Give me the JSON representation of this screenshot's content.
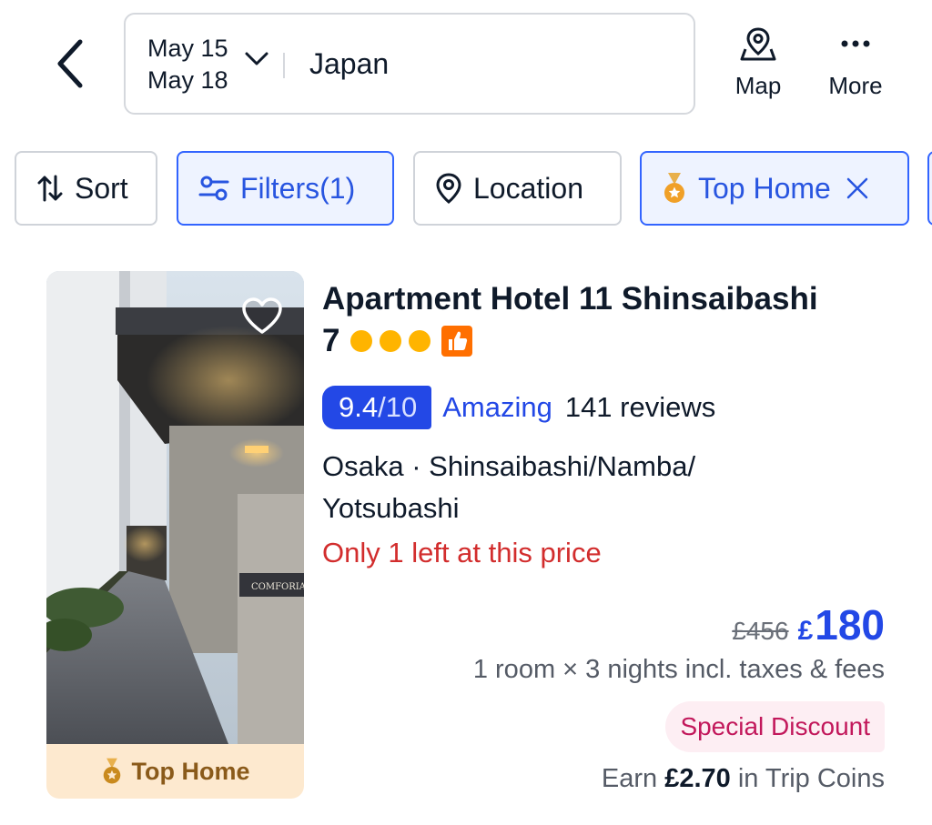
{
  "header": {
    "dates": {
      "check_in": "May 15",
      "check_out": "May 18"
    },
    "destination": "Japan",
    "map_label": "Map",
    "more_label": "More"
  },
  "filters": {
    "sort_label": "Sort",
    "filters_label": "Filters(1)",
    "location_label": "Location",
    "top_home_label": "Top Home"
  },
  "listing": {
    "name_line1": "Apartment Hotel 11 Shinsaibashi",
    "name_line2": "7",
    "star_rating": 3,
    "score_value": "9.4",
    "score_sep": "/",
    "score_max": "10",
    "rating_word": "Amazing",
    "reviews": "141 reviews",
    "location_line1": "Osaka · Shinsaibashi/Namba/",
    "location_line2": "Yotsubashi",
    "scarcity": "Only 1 left at this price",
    "old_price": "£456",
    "currency": "£",
    "price": "180",
    "price_note": "1 room × 3 nights incl. taxes & fees",
    "discount_label": "Special Discount",
    "coins_prefix": "Earn",
    "coins_amount": "£2.70",
    "coins_suffix": "in Trip Coins",
    "image_badge": "Top Home",
    "image_sign": "COMFORIA"
  },
  "colors": {
    "brand_blue": "#2348e6",
    "chip_active_bg": "#eef3ff",
    "scarcity_red": "#d22d2d",
    "discount_pink": "#c2185b",
    "medal_orange": "#f0a028",
    "star_yellow": "#ffb400"
  },
  "icons": {
    "back": "chevron-left-icon",
    "dates": "chevron-down-icon",
    "map": "map-pin-icon",
    "more": "ellipsis-icon",
    "sort": "sort-arrows-icon",
    "filters": "sliders-icon",
    "location": "location-pin-icon",
    "top_home": "medal-icon",
    "remove": "close-icon",
    "favorite": "heart-icon",
    "recommended": "thumbs-up-icon"
  }
}
